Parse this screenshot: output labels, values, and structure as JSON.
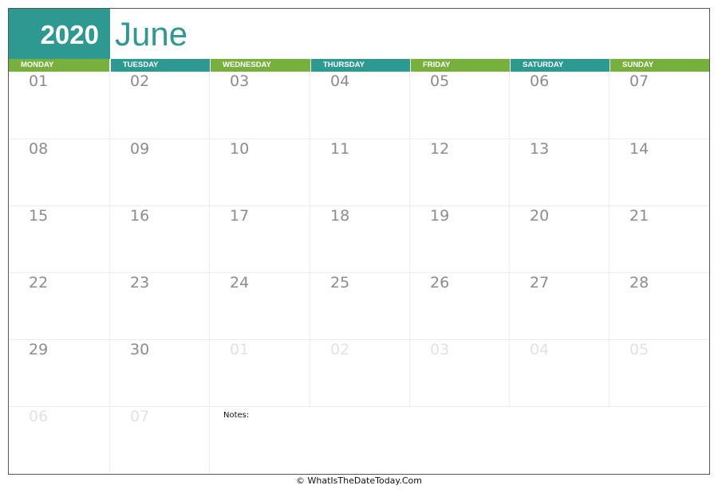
{
  "calendar": {
    "year": "2020",
    "month": "June",
    "weekdays": [
      {
        "label": "MONDAY",
        "color": "#78b03e"
      },
      {
        "label": "TUESDAY",
        "color": "#2e9990"
      },
      {
        "label": "WEDNESDAY",
        "color": "#78b03e"
      },
      {
        "label": "THURSDAY",
        "color": "#2e9990"
      },
      {
        "label": "FRIDAY",
        "color": "#78b03e"
      },
      {
        "label": "SATURDAY",
        "color": "#2e9990"
      },
      {
        "label": "SUNDAY",
        "color": "#78b03e"
      }
    ],
    "weeks": [
      [
        {
          "day": "01",
          "current": true
        },
        {
          "day": "02",
          "current": true
        },
        {
          "day": "03",
          "current": true
        },
        {
          "day": "04",
          "current": true
        },
        {
          "day": "05",
          "current": true
        },
        {
          "day": "06",
          "current": true
        },
        {
          "day": "07",
          "current": true
        }
      ],
      [
        {
          "day": "08",
          "current": true
        },
        {
          "day": "09",
          "current": true
        },
        {
          "day": "10",
          "current": true
        },
        {
          "day": "11",
          "current": true
        },
        {
          "day": "12",
          "current": true
        },
        {
          "day": "13",
          "current": true
        },
        {
          "day": "14",
          "current": true
        }
      ],
      [
        {
          "day": "15",
          "current": true
        },
        {
          "day": "16",
          "current": true
        },
        {
          "day": "17",
          "current": true
        },
        {
          "day": "18",
          "current": true
        },
        {
          "day": "19",
          "current": true
        },
        {
          "day": "20",
          "current": true
        },
        {
          "day": "21",
          "current": true
        }
      ],
      [
        {
          "day": "22",
          "current": true
        },
        {
          "day": "23",
          "current": true
        },
        {
          "day": "24",
          "current": true
        },
        {
          "day": "25",
          "current": true
        },
        {
          "day": "26",
          "current": true
        },
        {
          "day": "27",
          "current": true
        },
        {
          "day": "28",
          "current": true
        }
      ],
      [
        {
          "day": "29",
          "current": true
        },
        {
          "day": "30",
          "current": true
        },
        {
          "day": "01",
          "current": false
        },
        {
          "day": "02",
          "current": false
        },
        {
          "day": "03",
          "current": false
        },
        {
          "day": "04",
          "current": false
        },
        {
          "day": "05",
          "current": false
        }
      ],
      [
        {
          "day": "06",
          "current": false
        },
        {
          "day": "07",
          "current": false
        }
      ]
    ],
    "notes_label": "Notes:"
  },
  "footer": {
    "copyright": "© WhatIsTheDateToday.Com"
  },
  "colors": {
    "teal": "#2e9990",
    "green": "#78b03e",
    "day_number": "#8c8c8c",
    "day_number_muted": "#e2e2e2"
  }
}
